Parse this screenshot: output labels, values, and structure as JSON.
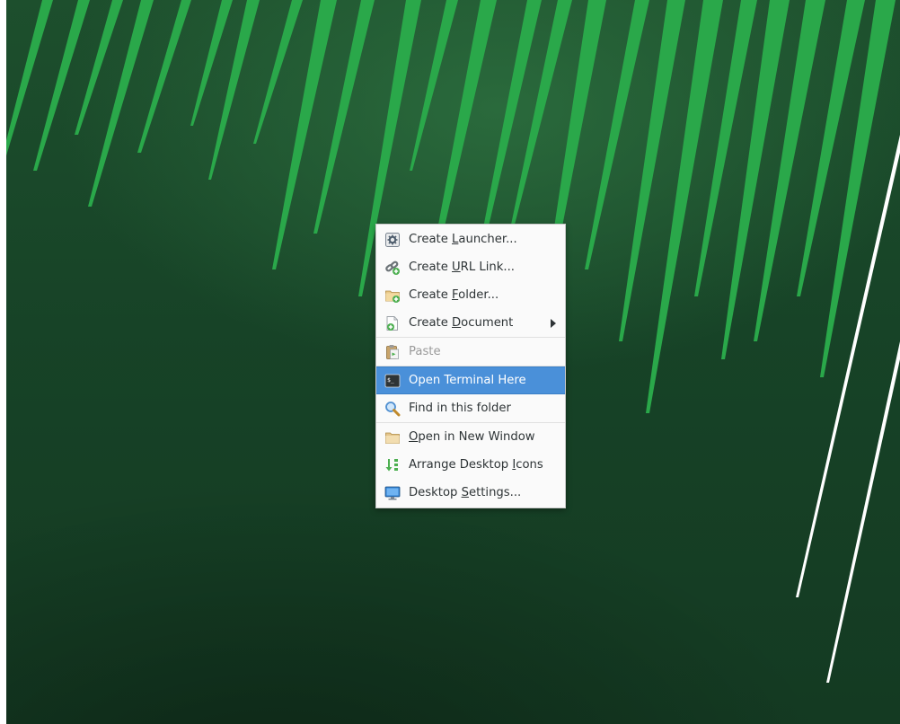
{
  "desktop": {
    "wallpaper_colors": {
      "base": "#174327",
      "streak": "#2aa84a",
      "streak_light": "#ffffff"
    }
  },
  "context_menu": {
    "selected_color": "#4a90d9",
    "items": [
      {
        "pre": "Create ",
        "mn": "L",
        "post": "auncher...",
        "icon": "launcher-gear-icon",
        "enabled": true
      },
      {
        "pre": "Create ",
        "mn": "U",
        "post": "RL Link...",
        "icon": "url-link-icon",
        "enabled": true
      },
      {
        "pre": "Create ",
        "mn": "F",
        "post": "older...",
        "icon": "new-folder-icon",
        "enabled": true
      },
      {
        "pre": "Create ",
        "mn": "D",
        "post": "ocument",
        "icon": "new-document-icon",
        "enabled": true,
        "submenu": true
      },
      {
        "pre": "Paste",
        "mn": "",
        "post": "",
        "icon": "paste-icon",
        "enabled": false
      },
      {
        "pre": "Open Terminal Here",
        "mn": "",
        "post": "",
        "icon": "terminal-icon",
        "enabled": true,
        "selected": true
      },
      {
        "pre": "Find in this folder",
        "mn": "",
        "post": "",
        "icon": "search-icon",
        "enabled": true
      },
      {
        "pre": "",
        "mn": "O",
        "post": "pen in New Window",
        "icon": "folder-icon",
        "enabled": true
      },
      {
        "pre": "Arrange Desktop ",
        "mn": "I",
        "post": "cons",
        "icon": "arrange-icon",
        "enabled": true
      },
      {
        "pre": "Desktop ",
        "mn": "S",
        "post": "ettings...",
        "icon": "desktop-settings-icon",
        "enabled": true
      }
    ]
  }
}
